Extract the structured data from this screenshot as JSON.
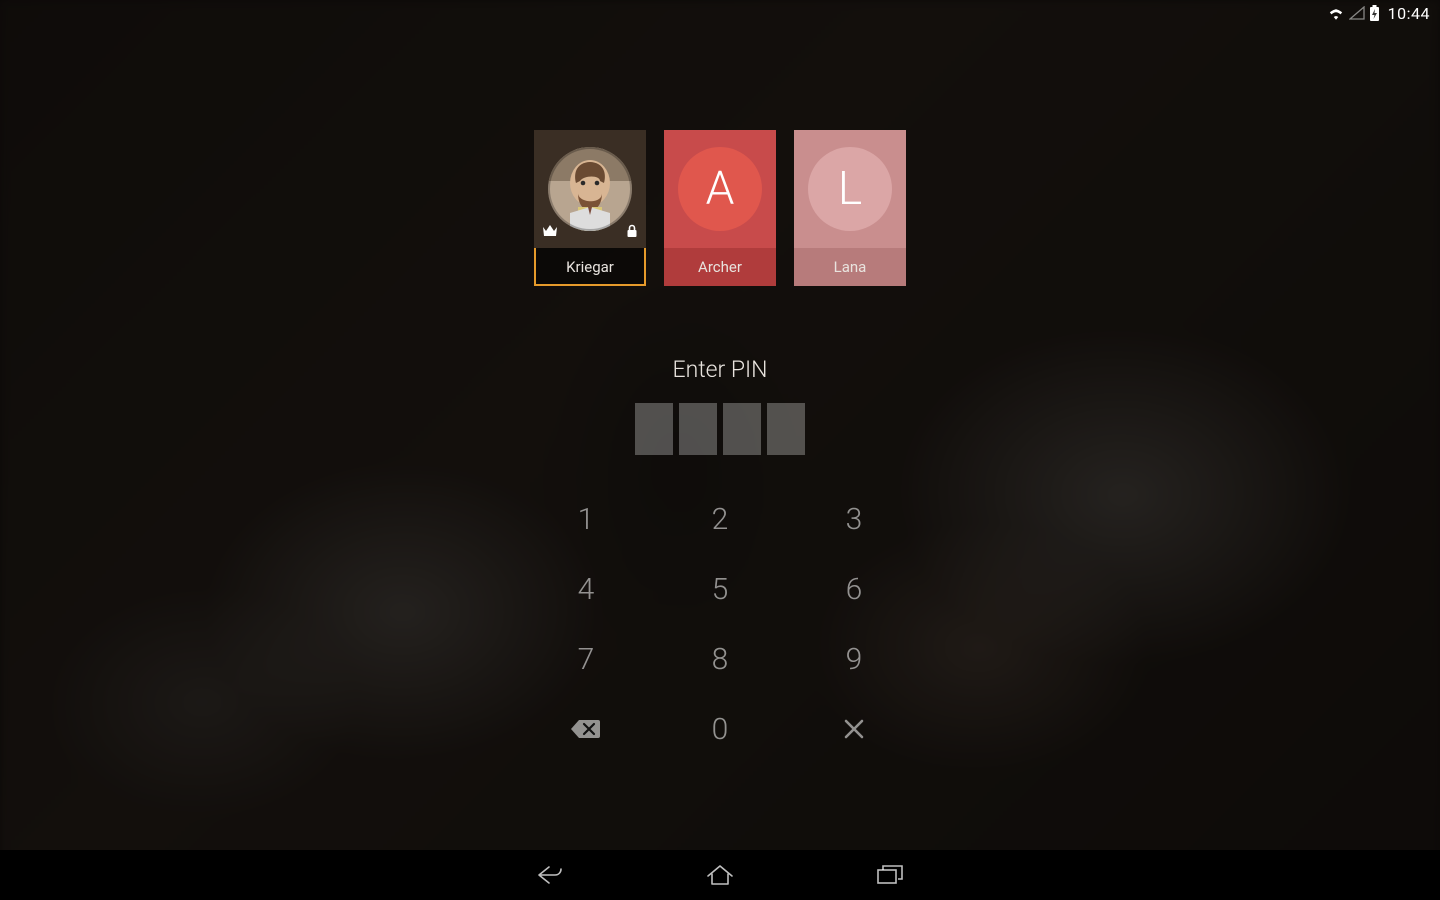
{
  "status_bar": {
    "time": "10:44"
  },
  "profiles": [
    {
      "name": "Kriegar",
      "selected": true,
      "has_image": true,
      "letter": "",
      "card_bg": "#3a2e24",
      "label_bg": "rgba(0,0,0,0.35)",
      "circle_bg": "",
      "crown": true,
      "lock": true
    },
    {
      "name": "Archer",
      "selected": false,
      "has_image": false,
      "letter": "A",
      "card_bg": "#c84b4b",
      "label_bg": "#b03c3c",
      "circle_bg": "#e0574d",
      "crown": false,
      "lock": false
    },
    {
      "name": "Lana",
      "selected": false,
      "has_image": false,
      "letter": "L",
      "card_bg": "#c98e8e",
      "label_bg": "#b77b7b",
      "circle_bg": "#dba6a6",
      "crown": false,
      "lock": false
    }
  ],
  "pin": {
    "title": "Enter PIN",
    "length": 4
  },
  "keypad": {
    "rows": [
      [
        "1",
        "2",
        "3"
      ],
      [
        "4",
        "5",
        "6"
      ],
      [
        "7",
        "8",
        "9"
      ],
      [
        "backspace",
        "0",
        "cancel"
      ]
    ]
  }
}
